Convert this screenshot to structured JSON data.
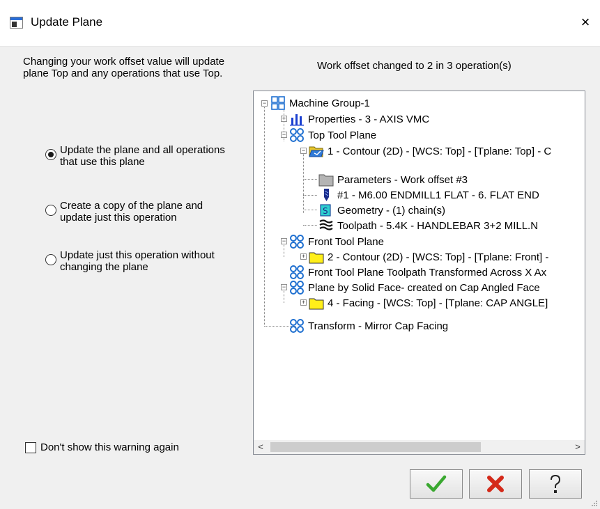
{
  "window": {
    "title": "Update Plane",
    "close_icon": "×"
  },
  "left": {
    "description": "Changing your work offset value will update plane Top and any operations that use Top.",
    "options": [
      {
        "label": "Update the plane and all operations that use this plane",
        "selected": true
      },
      {
        "label": "Create a copy of the plane and update just this operation",
        "selected": false
      },
      {
        "label": "Update just this operation without changing the plane",
        "selected": false
      }
    ],
    "dont_show_label": "Don't show this warning again",
    "dont_show_checked": false
  },
  "right": {
    "status": "Work offset changed to 2 in 3 operation(s)",
    "tree": [
      {
        "label": "Machine Group-1",
        "icon": "machine-group-icon"
      },
      {
        "label": "Properties - 3 - AXIS VMC",
        "icon": "properties-icon"
      },
      {
        "label": "Top Tool Plane",
        "icon": "plane-icon"
      },
      {
        "label": "1 - Contour (2D) - [WCS: Top] - [Tplane: Top] - C",
        "icon": "operation-folder-icon"
      },
      {
        "label": "Parameters - Work offset #3",
        "icon": "parameters-folder-icon"
      },
      {
        "label": "#1 - M6.00 ENDMILL1 FLAT - 6. FLAT END",
        "icon": "tool-icon"
      },
      {
        "label": "Geometry -  (1) chain(s)",
        "icon": "geometry-icon"
      },
      {
        "label": "Toolpath - 5.4K - HANDLEBAR 3+2 MILL.N",
        "icon": "toolpath-icon"
      },
      {
        "label": "Front Tool Plane",
        "icon": "plane-icon"
      },
      {
        "label": "2 - Contour (2D) - [WCS: Top] - [Tplane: Front] -",
        "icon": "operation-folder-icon"
      },
      {
        "label": "Front Tool Plane Toolpath Transformed Across X Ax",
        "icon": "plane-icon"
      },
      {
        "label": "Plane by Solid Face- created on Cap Angled Face",
        "icon": "plane-icon"
      },
      {
        "label": "4 - Facing - [WCS: Top] - [Tplane: CAP ANGLE]",
        "icon": "operation-folder-icon"
      },
      {
        "label": "Transform - Mirror Cap Facing",
        "icon": "plane-icon"
      }
    ],
    "scroll_left": "<",
    "scroll_right": ">"
  },
  "buttons": {
    "ok_icon": "checkmark-icon",
    "cancel_icon": "cross-icon",
    "help_icon": "question-icon",
    "ok_color": "#3aa830",
    "cancel_color": "#d42a1a"
  }
}
